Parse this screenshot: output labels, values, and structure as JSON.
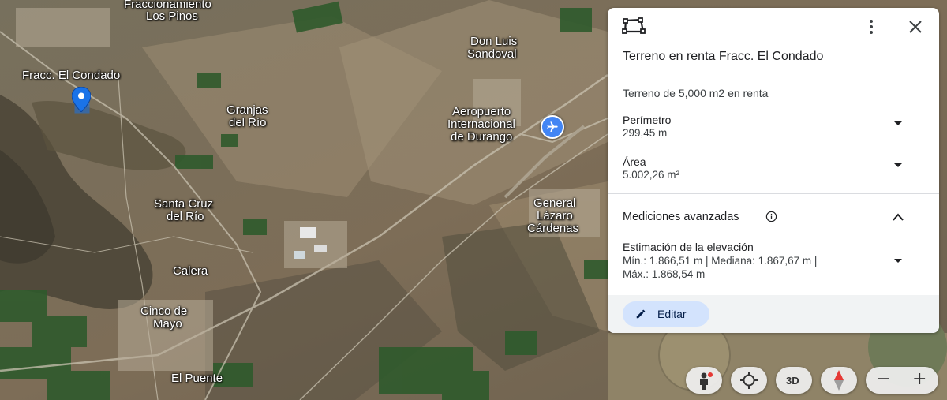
{
  "map": {
    "labels": [
      "Fraccionamiento",
      "Los Pinos",
      "Fracc. El Condado",
      "Granjas",
      "del Río",
      "Don Luis",
      "Sandoval",
      "Aeropuerto",
      "Internacional",
      "de Durango",
      "Santa Cruz",
      "del Río",
      "General",
      "Lázaro",
      "Cárdenas",
      "Calera",
      "Cinco de",
      "Mayo",
      "El Puente"
    ]
  },
  "panel": {
    "title": "Terreno en renta Fracc. El Condado",
    "description": "Terreno de 5,000 m2 en renta",
    "perimeter_label": "Perímetro",
    "perimeter_value": "299,45 m",
    "area_label": "Área",
    "area_value": "5.002,26 m²",
    "advanced_label": "Mediciones avanzadas",
    "elevation_label": "Estimación de la elevación",
    "elevation_line1": "Mín.: 1.866,51 m | Mediana: 1.867,67 m |",
    "elevation_line2": "Máx.: 1.868,54 m",
    "edit_label": "Editar"
  },
  "controls": {
    "view_3d_label": "3D",
    "zoom_out": "−",
    "zoom_in": "+"
  },
  "icons": [
    "polygon-icon",
    "more-vert-icon",
    "close-icon",
    "chevron-down-icon",
    "info-icon",
    "chevron-up-icon",
    "pencil-icon",
    "pegman-icon",
    "locate-icon",
    "compass-icon",
    "location-pin-icon",
    "airport-icon"
  ],
  "colors": {
    "accent": "#d3e3fd",
    "pin": "#1a73e8",
    "airport": "#4285f4"
  }
}
